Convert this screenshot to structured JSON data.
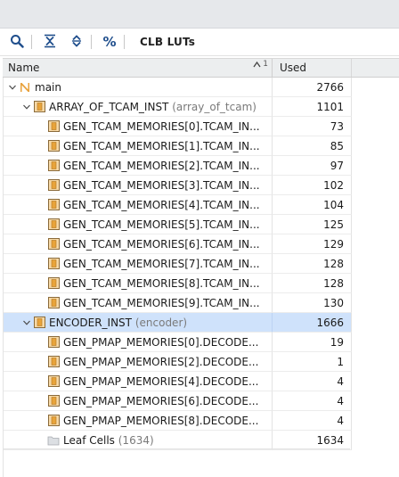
{
  "toolbar": {
    "metric_label": "CLB LUTs",
    "buttons": [
      {
        "icon": "search-icon"
      },
      {
        "icon": "collapse-all-icon"
      },
      {
        "icon": "expand-all-icon"
      },
      {
        "icon": "percent-icon",
        "glyph": "%"
      }
    ]
  },
  "table": {
    "col_name": "Name",
    "col_used": "Used",
    "sort_index": "1",
    "rows": [
      {
        "label": "main",
        "sub": "",
        "used": "2766",
        "level": 0,
        "expander": "expanded",
        "icon": "n-cell-icon",
        "selected": false
      },
      {
        "label": "ARRAY_OF_TCAM_INST",
        "sub": " (array_of_tcam)",
        "used": "1101",
        "level": 1,
        "expander": "expanded",
        "icon": "instance-icon",
        "selected": false
      },
      {
        "label": "GEN_TCAM_MEMORIES[0].TCAM_IN...",
        "sub": "",
        "used": "73",
        "level": 2,
        "expander": "none",
        "icon": "instance-icon",
        "selected": false
      },
      {
        "label": "GEN_TCAM_MEMORIES[1].TCAM_IN...",
        "sub": "",
        "used": "85",
        "level": 2,
        "expander": "none",
        "icon": "instance-icon",
        "selected": false
      },
      {
        "label": "GEN_TCAM_MEMORIES[2].TCAM_IN...",
        "sub": "",
        "used": "97",
        "level": 2,
        "expander": "none",
        "icon": "instance-icon",
        "selected": false
      },
      {
        "label": "GEN_TCAM_MEMORIES[3].TCAM_IN...",
        "sub": "",
        "used": "102",
        "level": 2,
        "expander": "none",
        "icon": "instance-icon",
        "selected": false
      },
      {
        "label": "GEN_TCAM_MEMORIES[4].TCAM_IN...",
        "sub": "",
        "used": "104",
        "level": 2,
        "expander": "none",
        "icon": "instance-icon",
        "selected": false
      },
      {
        "label": "GEN_TCAM_MEMORIES[5].TCAM_IN...",
        "sub": "",
        "used": "125",
        "level": 2,
        "expander": "none",
        "icon": "instance-icon",
        "selected": false
      },
      {
        "label": "GEN_TCAM_MEMORIES[6].TCAM_IN...",
        "sub": "",
        "used": "129",
        "level": 2,
        "expander": "none",
        "icon": "instance-icon",
        "selected": false
      },
      {
        "label": "GEN_TCAM_MEMORIES[7].TCAM_IN...",
        "sub": "",
        "used": "128",
        "level": 2,
        "expander": "none",
        "icon": "instance-icon",
        "selected": false
      },
      {
        "label": "GEN_TCAM_MEMORIES[8].TCAM_IN...",
        "sub": "",
        "used": "128",
        "level": 2,
        "expander": "none",
        "icon": "instance-icon",
        "selected": false
      },
      {
        "label": "GEN_TCAM_MEMORIES[9].TCAM_IN...",
        "sub": "",
        "used": "130",
        "level": 2,
        "expander": "none",
        "icon": "instance-icon",
        "selected": false
      },
      {
        "label": "ENCODER_INST",
        "sub": " (encoder)",
        "used": "1666",
        "level": 1,
        "expander": "expanded",
        "icon": "instance-icon",
        "selected": true
      },
      {
        "label": "GEN_PMAP_MEMORIES[0].DECODE...",
        "sub": "",
        "used": "19",
        "level": 2,
        "expander": "none",
        "icon": "instance-icon",
        "selected": false
      },
      {
        "label": "GEN_PMAP_MEMORIES[2].DECODE...",
        "sub": "",
        "used": "1",
        "level": 2,
        "expander": "none",
        "icon": "instance-icon",
        "selected": false
      },
      {
        "label": "GEN_PMAP_MEMORIES[4].DECODE...",
        "sub": "",
        "used": "4",
        "level": 2,
        "expander": "none",
        "icon": "instance-icon",
        "selected": false
      },
      {
        "label": "GEN_PMAP_MEMORIES[6].DECODE...",
        "sub": "",
        "used": "4",
        "level": 2,
        "expander": "none",
        "icon": "instance-icon",
        "selected": false
      },
      {
        "label": "GEN_PMAP_MEMORIES[8].DECODE...",
        "sub": "",
        "used": "4",
        "level": 2,
        "expander": "none",
        "icon": "instance-icon",
        "selected": false
      },
      {
        "label": "Leaf Cells",
        "sub": " (1634)",
        "used": "1634",
        "level": 2,
        "expander": "none",
        "icon": "folder-icon",
        "selected": false
      }
    ]
  },
  "colors": {
    "selection": "#cfe2fb",
    "instance_icon": "#e8a33a",
    "n_icon": "#e8a13a"
  }
}
